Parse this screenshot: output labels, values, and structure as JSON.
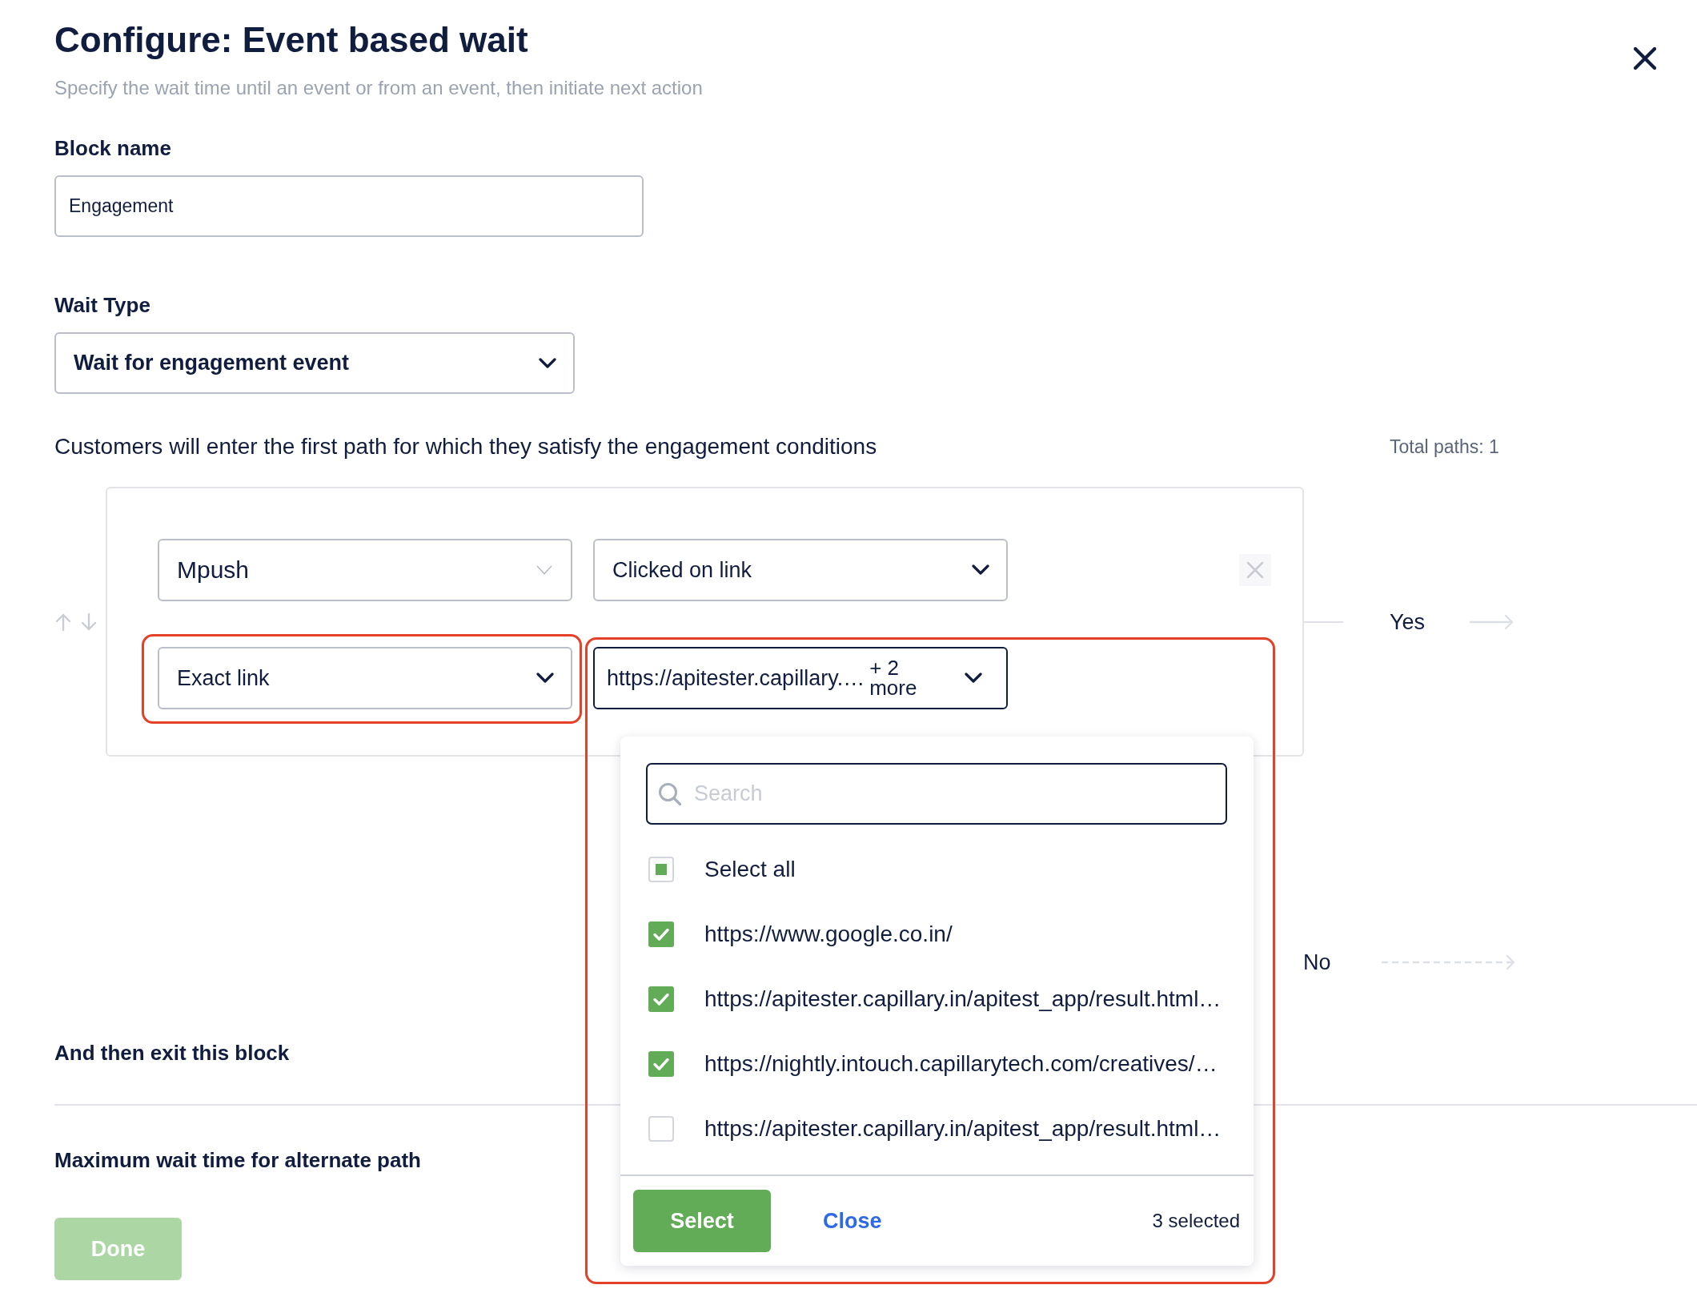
{
  "header": {
    "title": "Configure: Event based wait",
    "subtitle": "Specify the wait time until an event or from an event, then initiate next action"
  },
  "block_name": {
    "label": "Block name",
    "value": "Engagement"
  },
  "wait_type": {
    "label": "Wait Type",
    "value": "Wait for engagement event"
  },
  "paths": {
    "description": "Customers will enter the first path for which they satisfy the engagement conditions",
    "total": "Total paths: 1",
    "path": {
      "condition_rows": [
        [
          {
            "kind": "basic",
            "value": "Mpush",
            "highlighted": false,
            "expanded": false
          },
          {
            "kind": "standard",
            "value": "Clicked on link",
            "highlighted": false,
            "expanded": false
          }
        ],
        [
          {
            "kind": "standard",
            "value": "Exact link",
            "highlighted": true,
            "expanded": false
          },
          {
            "kind": "multi",
            "value": "https://apitester.capillary.…",
            "more": "+ 2 more",
            "highlighted": true,
            "expanded": true,
            "dropdown": {
              "search": {
                "placeholder": "Search"
              },
              "select_all": {
                "label": "Select all",
                "checked": false,
                "partial": true
              },
              "options": [
                {
                  "label": "https://www.google.co.in/",
                  "checked": true
                },
                {
                  "label": "https://apitester.capillary.in/apitest_app/result.html…",
                  "checked": true
                },
                {
                  "label": "https://nightly.intouch.capillarytech.com/creatives/…",
                  "checked": true
                },
                {
                  "label": "https://apitester.capillary.in/apitest_app/result.html…",
                  "checked": false
                }
              ],
              "footer": {
                "select_button": "Select",
                "close_link": "Close",
                "count": "3 selected"
              }
            }
          }
        ]
      ],
      "yes_label": "Yes"
    },
    "no_label": "No"
  },
  "exit_label": "And then exit this block",
  "max_wait_label": "Maximum wait time for alternate path",
  "done_button": {
    "label": "Done",
    "disabled": true
  }
}
